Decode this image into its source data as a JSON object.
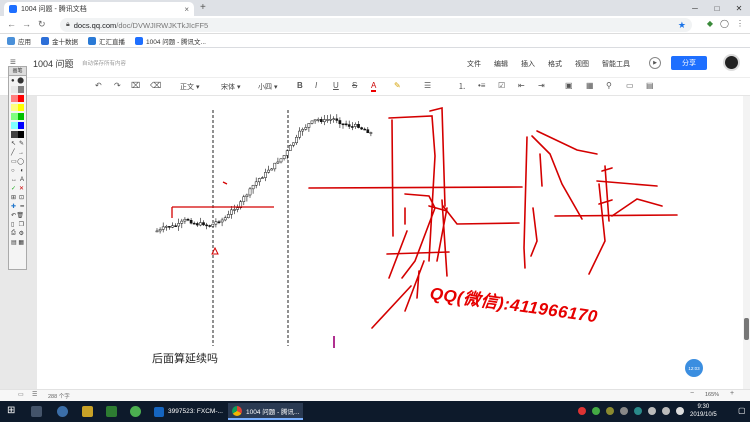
{
  "browser": {
    "tab_title": "1004 问题 - 腾讯文档",
    "url_domain": "docs.qq.com",
    "url_path": "/doc/DVWJIRWJKTkJIcFF5",
    "bookmarks": [
      {
        "label": "应用",
        "color": "#4a90d9"
      },
      {
        "label": "金十数据",
        "color": "#2d6fd8"
      },
      {
        "label": "汇汇直播",
        "color": "#2a7ad6"
      },
      {
        "label": "1004 问题 - 腾讯文...",
        "color": "#1e6fff"
      }
    ]
  },
  "doc": {
    "title": "1004 问题",
    "autosave": "自动保存所有内容",
    "menus": [
      "文件",
      "编辑",
      "插入",
      "格式",
      "视图",
      "智能工具"
    ],
    "share_label": "分享",
    "toolbar": {
      "style": "正文",
      "font": "宋体",
      "size": "小四",
      "bold": "B",
      "italic": "I",
      "underline": "U",
      "strike": "S",
      "font_color": "A"
    },
    "caption": "后面算延续吗",
    "annotation": "QQ(微信):411966170",
    "word_count": "288 个字",
    "zoom": "165%",
    "help_bubble": "12:03"
  },
  "palette": {
    "title": "画笔",
    "colors": [
      "#e8e8e8",
      "#808080",
      "#ff7f7f",
      "#ff0000",
      "#ffff80",
      "#ffff00",
      "#80ff80",
      "#00c000",
      "#80ffff",
      "#0000ff",
      "#404040",
      "#000000"
    ]
  },
  "taskbar": {
    "apps": [
      "3997523: FXCM-...",
      "1004 问题 - 腾讯..."
    ],
    "time": "9:30",
    "date": "2019/10/5"
  },
  "colors": {
    "accent": "#1e6fff",
    "annotation_red": "#e60000"
  }
}
